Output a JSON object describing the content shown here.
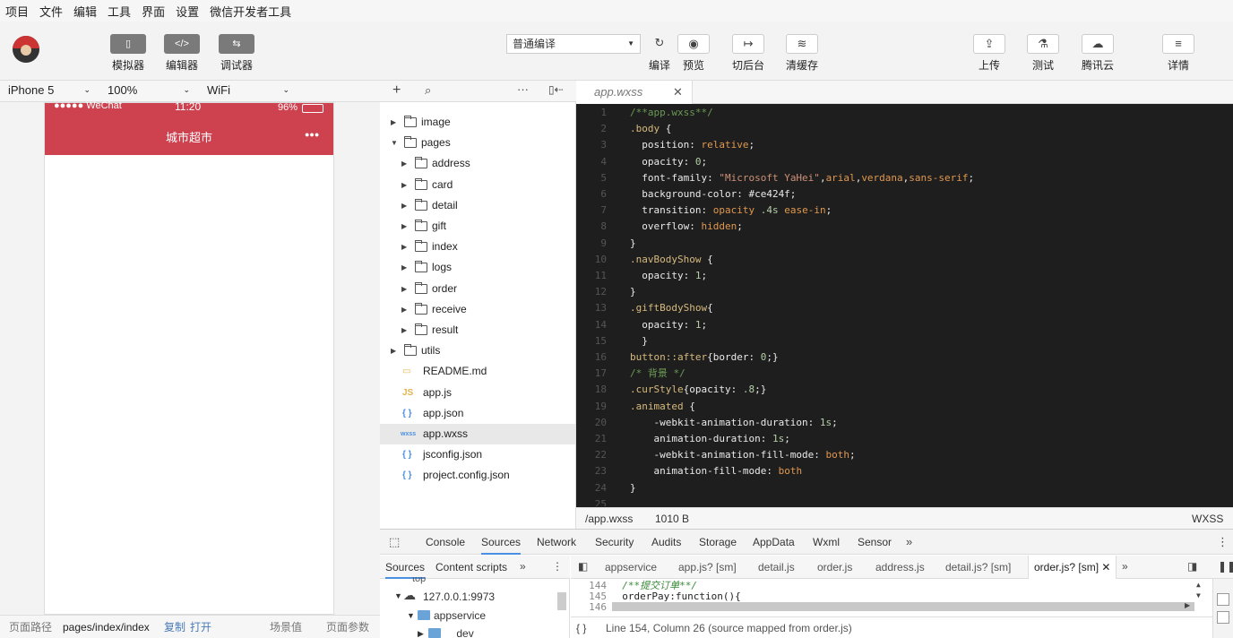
{
  "menu": [
    "项目",
    "文件",
    "编辑",
    "工具",
    "界面",
    "设置",
    "微信开发者工具"
  ],
  "toolbar": {
    "modes": [
      {
        "label": "模拟器",
        "glyph": "▯"
      },
      {
        "label": "编辑器",
        "glyph": "</>"
      },
      {
        "label": "调试器",
        "glyph": "⇆"
      }
    ],
    "compile_mode": "普通编译",
    "actions": [
      {
        "label": "编译",
        "glyph": "↻"
      },
      {
        "label": "预览",
        "glyph": "◉"
      },
      {
        "label": "切后台",
        "glyph": "↦"
      },
      {
        "label": "清缓存",
        "glyph": "≋"
      }
    ],
    "right": [
      {
        "label": "上传",
        "glyph": "⇪"
      },
      {
        "label": "测试",
        "glyph": "⚗"
      },
      {
        "label": "腾讯云",
        "glyph": "☁"
      },
      {
        "label": "详情",
        "glyph": "≡"
      }
    ]
  },
  "simulator": {
    "device": "iPhone 5",
    "zoom": "100%",
    "network": "WiFi",
    "status_carrier": "●●●●● WeChat",
    "status_time": "11:20",
    "status_battery": "96%",
    "nav_title": "城市超市",
    "nav_menu": "●●●",
    "nav_color": "#ce424f"
  },
  "filetree": {
    "items": [
      {
        "name": "image",
        "type": "folder",
        "depth": 0,
        "open": false
      },
      {
        "name": "pages",
        "type": "folder",
        "depth": 0,
        "open": true
      },
      {
        "name": "address",
        "type": "folder",
        "depth": 1,
        "open": false
      },
      {
        "name": "card",
        "type": "folder",
        "depth": 1,
        "open": false
      },
      {
        "name": "detail",
        "type": "folder",
        "depth": 1,
        "open": false
      },
      {
        "name": "gift",
        "type": "folder",
        "depth": 1,
        "open": false
      },
      {
        "name": "index",
        "type": "folder",
        "depth": 1,
        "open": false
      },
      {
        "name": "logs",
        "type": "folder",
        "depth": 1,
        "open": false
      },
      {
        "name": "order",
        "type": "folder",
        "depth": 1,
        "open": false
      },
      {
        "name": "receive",
        "type": "folder",
        "depth": 1,
        "open": false
      },
      {
        "name": "result",
        "type": "folder",
        "depth": 1,
        "open": false
      },
      {
        "name": "utils",
        "type": "folder",
        "depth": 0,
        "open": false
      },
      {
        "name": "README.md",
        "type": "md",
        "depth": 0
      },
      {
        "name": "app.js",
        "type": "js",
        "depth": 0
      },
      {
        "name": "app.json",
        "type": "json",
        "depth": 0
      },
      {
        "name": "app.wxss",
        "type": "wxss",
        "depth": 0,
        "selected": true
      },
      {
        "name": "jsconfig.json",
        "type": "json",
        "depth": 0
      },
      {
        "name": "project.config.json",
        "type": "json",
        "depth": 0
      }
    ]
  },
  "editor": {
    "tab": "app.wxss",
    "lines": [
      [
        [
          "c-com",
          "/**app.wxss**/"
        ]
      ],
      [
        [
          "c-sel",
          ".body "
        ],
        [
          "c-key",
          "{"
        ]
      ],
      [
        [
          "c-key",
          "  position: "
        ],
        [
          "c-val",
          "relative"
        ],
        [
          "c-key",
          ";"
        ]
      ],
      [
        [
          "c-key",
          "  opacity: "
        ],
        [
          "c-num",
          "0"
        ],
        [
          "c-key",
          ";"
        ]
      ],
      [
        [
          "c-key",
          "  font-family: "
        ],
        [
          "c-str",
          "\"Microsoft YaHei\""
        ],
        [
          "c-key",
          ","
        ],
        [
          "c-val",
          "arial"
        ],
        [
          "c-key",
          ","
        ],
        [
          "c-val",
          "verdana"
        ],
        [
          "c-key",
          ","
        ],
        [
          "c-val",
          "sans-serif"
        ],
        [
          "c-key",
          ";"
        ]
      ],
      [
        [
          "c-key",
          "  background-color: #ce424f;"
        ]
      ],
      [
        [
          "c-key",
          "  transition: "
        ],
        [
          "c-val",
          "opacity"
        ],
        [
          "c-key",
          " "
        ],
        [
          "c-num",
          ".4s"
        ],
        [
          "c-key",
          " "
        ],
        [
          "c-val",
          "ease-in"
        ],
        [
          "c-key",
          ";"
        ]
      ],
      [
        [
          "c-key",
          "  overflow: "
        ],
        [
          "c-val",
          "hidden"
        ],
        [
          "c-key",
          ";"
        ]
      ],
      [
        [
          "c-key",
          "}"
        ]
      ],
      [
        [
          "c-sel",
          ".navBodyShow "
        ],
        [
          "c-key",
          "{"
        ]
      ],
      [
        [
          "c-key",
          "  opacity: "
        ],
        [
          "c-num",
          "1"
        ],
        [
          "c-key",
          ";"
        ]
      ],
      [
        [
          "c-key",
          "}"
        ]
      ],
      [
        [
          "c-sel",
          ".giftBodyShow"
        ],
        [
          "c-key",
          "{"
        ]
      ],
      [
        [
          "c-key",
          "  opacity: "
        ],
        [
          "c-num",
          "1"
        ],
        [
          "c-key",
          ";"
        ]
      ],
      [
        [
          "c-key",
          "  }"
        ]
      ],
      [
        [
          "c-sel",
          "button::after"
        ],
        [
          "c-key",
          "{border: "
        ],
        [
          "c-num",
          "0"
        ],
        [
          "c-key",
          ";}"
        ]
      ],
      [
        [
          "c-com",
          "/* 背景 */"
        ]
      ],
      [
        [
          "c-sel",
          ".curStyle"
        ],
        [
          "c-key",
          "{opacity: "
        ],
        [
          "c-num",
          ".8"
        ],
        [
          "c-key",
          ";}"
        ]
      ],
      [
        [
          "c-sel",
          ".animated "
        ],
        [
          "c-key",
          "{"
        ]
      ],
      [
        [
          "c-key",
          "    -webkit-animation-duration: "
        ],
        [
          "c-num",
          "1s"
        ],
        [
          "c-key",
          ";"
        ]
      ],
      [
        [
          "c-key",
          "    animation-duration: "
        ],
        [
          "c-num",
          "1s"
        ],
        [
          "c-key",
          ";"
        ]
      ],
      [
        [
          "c-key",
          "    -webkit-animation-fill-mode: "
        ],
        [
          "c-val",
          "both"
        ],
        [
          "c-key",
          ";"
        ]
      ],
      [
        [
          "c-key",
          "    animation-fill-mode: "
        ],
        [
          "c-val",
          "both"
        ]
      ],
      [
        [
          "c-key",
          "}"
        ]
      ],
      [
        [
          "c-key",
          ""
        ]
      ]
    ],
    "status_path": "/app.wxss",
    "status_size": "1010 B",
    "status_lang": "WXSS"
  },
  "devtools": {
    "tabs": [
      "Console",
      "Sources",
      "Network",
      "Security",
      "Audits",
      "Storage",
      "AppData",
      "Wxml",
      "Sensor"
    ],
    "active_tab": "Sources",
    "nav_tabs": [
      "Sources",
      "Content scripts"
    ],
    "tree": [
      "top",
      "127.0.0.1:9973",
      "appservice",
      "__dev__"
    ],
    "file_tabs": [
      "appservice",
      "app.js? [sm]",
      "detail.js",
      "order.js",
      "address.js",
      "detail.js? [sm]",
      "order.js? [sm]"
    ],
    "code_lines": [
      {
        "n": "144",
        "t": "  /**提交订单**/"
      },
      {
        "n": "145",
        "t": "  orderPay:function(){"
      },
      {
        "n": "146",
        "t": ""
      }
    ],
    "status": "Line 154, Column 26   (source mapped from order.js)"
  },
  "bottombar": {
    "path_label": "页面路径",
    "path": "pages/index/index",
    "copy": "复制",
    "open": "打开",
    "scene": "场景值",
    "params": "页面参数"
  }
}
